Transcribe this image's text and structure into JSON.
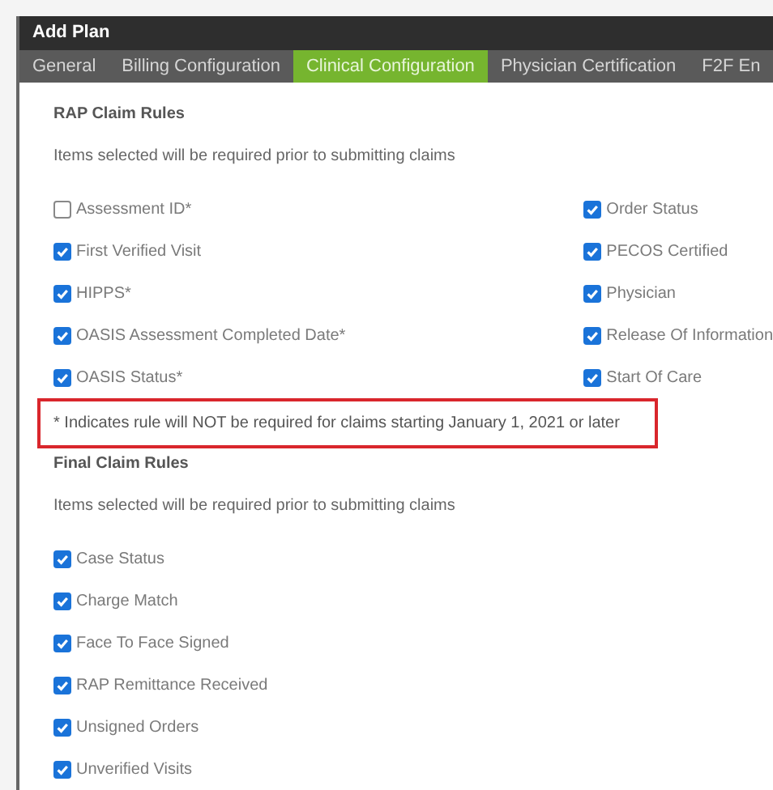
{
  "window": {
    "title": "Add Plan"
  },
  "tabs": [
    {
      "label": "General",
      "selected": false
    },
    {
      "label": "Billing Configuration",
      "selected": false
    },
    {
      "label": "Clinical Configuration",
      "selected": true
    },
    {
      "label": "Physician Certification",
      "selected": false
    },
    {
      "label": "F2F En",
      "selected": false
    }
  ],
  "rap_claim_rules": {
    "heading": "RAP Claim Rules",
    "subtitle": "Items selected will be required prior to submitting claims",
    "left_items": [
      {
        "label": "Assessment ID*",
        "checked": false
      },
      {
        "label": "First Verified Visit",
        "checked": true
      },
      {
        "label": "HIPPS*",
        "checked": true
      },
      {
        "label": "OASIS Assessment Completed Date*",
        "checked": true
      },
      {
        "label": "OASIS Status*",
        "checked": true
      }
    ],
    "right_items": [
      {
        "label": "Order Status",
        "checked": true
      },
      {
        "label": "PECOS Certified",
        "checked": true
      },
      {
        "label": "Physician",
        "checked": true
      },
      {
        "label": "Release Of Information",
        "checked": true
      },
      {
        "label": "Start Of Care",
        "checked": true
      }
    ],
    "note": "* Indicates rule will NOT be required for claims starting January 1, 2021 or later"
  },
  "final_claim_rules": {
    "heading": "Final Claim Rules",
    "subtitle": "Items selected will be required prior to submitting claims",
    "items": [
      {
        "label": "Case Status",
        "checked": true
      },
      {
        "label": "Charge Match",
        "checked": true
      },
      {
        "label": "Face To Face Signed",
        "checked": true
      },
      {
        "label": "RAP Remittance Received",
        "checked": true
      },
      {
        "label": "Unsigned Orders",
        "checked": true
      },
      {
        "label": "Unverified Visits",
        "checked": true
      }
    ]
  }
}
